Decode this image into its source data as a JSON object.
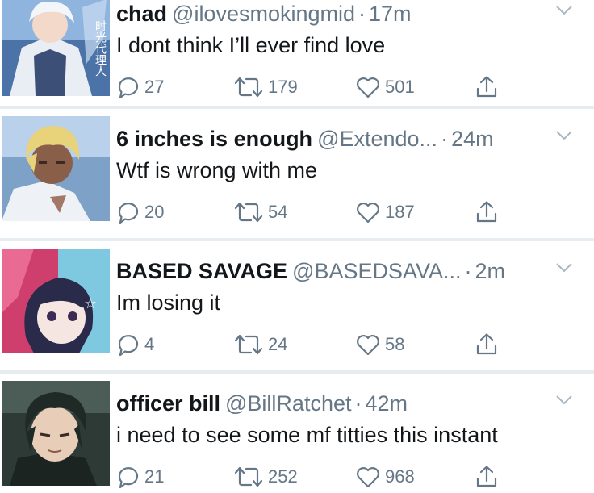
{
  "feed": {
    "tweets": [
      {
        "display_name": "chad",
        "handle": "@ilovesmokingmid",
        "separator": "·",
        "time": "17m",
        "text": "I dont think I’ll ever find love",
        "replies": "27",
        "retweets": "179",
        "likes": "501",
        "avatar_caption": "时光代理人"
      },
      {
        "display_name": "6 inches is enough",
        "handle": "@Extendo...",
        "separator": "·",
        "time": "24m",
        "text": "Wtf is wrong with me",
        "replies": "20",
        "retweets": "54",
        "likes": "187"
      },
      {
        "display_name": "BASED SAVAGE",
        "handle": "@BASEDSAVA...",
        "separator": "·",
        "time": "2m",
        "text": "Im losing it",
        "replies": "4",
        "retweets": "24",
        "likes": "58"
      },
      {
        "display_name": "officer bill",
        "handle": "@BillRatchet",
        "separator": "·",
        "time": "42m",
        "text": "i need to see some mf titties this instant",
        "replies": "21",
        "retweets": "252",
        "likes": "968"
      }
    ]
  },
  "icons": {
    "reply": "reply-icon",
    "retweet": "retweet-icon",
    "like": "heart-icon",
    "share": "share-icon",
    "menu": "chevron-down-icon"
  },
  "colors": {
    "text_primary": "#14171a",
    "text_secondary": "#657786",
    "divider": "#e6ecf0",
    "icon": "#657786"
  }
}
